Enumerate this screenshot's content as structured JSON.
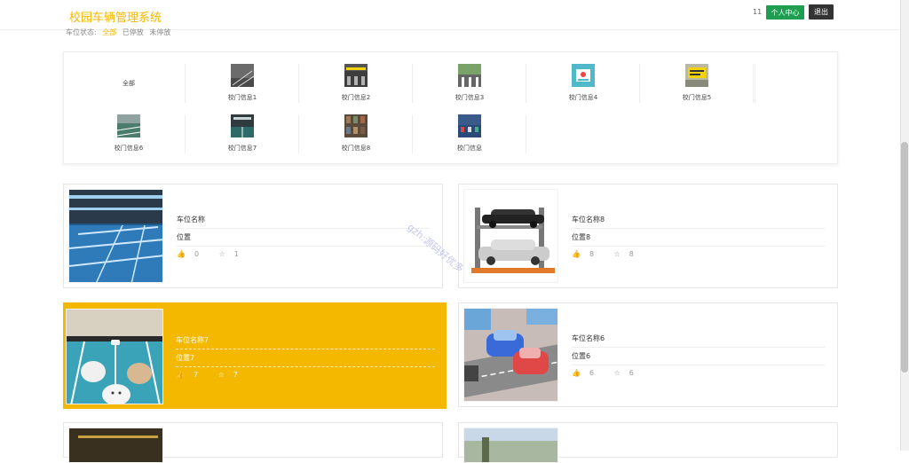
{
  "header": {
    "title": "校园车辆管理系统",
    "user_count": "11",
    "profile_label": "个人中心",
    "logout_label": "退出"
  },
  "status_filter": {
    "label": "车位状态:",
    "options": [
      "全部",
      "已停放",
      "未停放"
    ],
    "selected": "全部"
  },
  "categories": [
    {
      "label": "全部"
    },
    {
      "label": "校门信息1"
    },
    {
      "label": "校门信息2"
    },
    {
      "label": "校门信息3"
    },
    {
      "label": "校门信息4"
    },
    {
      "label": "校门信息5"
    },
    {
      "label": "校门信息6"
    },
    {
      "label": "校门信息7"
    },
    {
      "label": "校门信息8"
    },
    {
      "label": "校门信息"
    }
  ],
  "cards": [
    {
      "name": "车位名称",
      "location": "位置",
      "likes": "0",
      "favorites": "1"
    },
    {
      "name": "车位名称8",
      "location": "位置8",
      "likes": "8",
      "favorites": "8"
    },
    {
      "name": "车位名称7",
      "location": "位置7",
      "likes": "7",
      "favorites": "7"
    },
    {
      "name": "车位名称6",
      "location": "位置6",
      "likes": "6",
      "favorites": "6"
    }
  ],
  "watermark": "gzh:源码好优多",
  "colors": {
    "accent": "#f5b800",
    "profile_button": "#1e9e50",
    "logout_button": "#333333"
  }
}
